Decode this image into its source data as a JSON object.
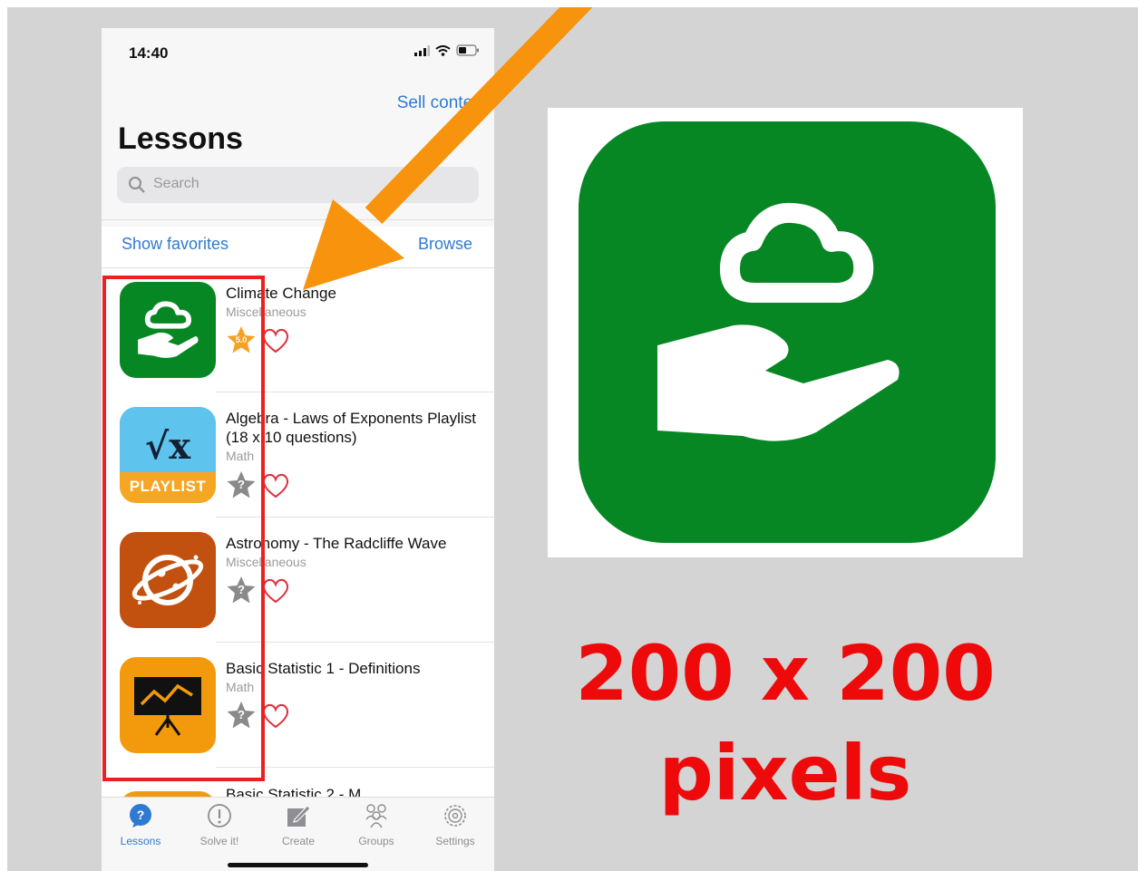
{
  "status": {
    "time": "14:40"
  },
  "header": {
    "sell_link": "Sell content",
    "title": "Lessons"
  },
  "search": {
    "placeholder": "Search"
  },
  "filters": {
    "show_favorites": "Show favorites",
    "browse": "Browse"
  },
  "lessons": [
    {
      "title": "Climate Change",
      "category": "Miscellaneous",
      "rating": "5.0",
      "icon": "cloud-hand-icon"
    },
    {
      "title": "Algebra - Laws of Exponents Playlist (18 x 10 questions)",
      "category": "Math",
      "rating": "?",
      "icon_badge": "PLAYLIST",
      "icon_symbol": "√x"
    },
    {
      "title": "Astronomy - The Radcliffe Wave",
      "category": "Miscellaneous",
      "rating": "?",
      "icon": "planet-icon"
    },
    {
      "title": "Basic Statistic 1 - Definitions",
      "category": "Math",
      "rating": "?",
      "icon": "chart-board-icon"
    },
    {
      "title": "Basic Statistic 2 - M",
      "partial": true
    }
  ],
  "tabs": [
    {
      "label": "Lessons",
      "icon": "question-bubble-icon",
      "active": true
    },
    {
      "label": "Solve it!",
      "icon": "exclamation-circle-icon"
    },
    {
      "label": "Create",
      "icon": "pencil-square-icon"
    },
    {
      "label": "Groups",
      "icon": "people-icon"
    },
    {
      "label": "Settings",
      "icon": "gear-icon"
    }
  ],
  "caption": {
    "size": "200 x 200",
    "unit": "pixels"
  },
  "colors": {
    "accent_blue": "#2f7ad1",
    "icon_green": "#068723",
    "annotation_red": "#ee0a0a",
    "arrow_orange": "#f7930c"
  }
}
